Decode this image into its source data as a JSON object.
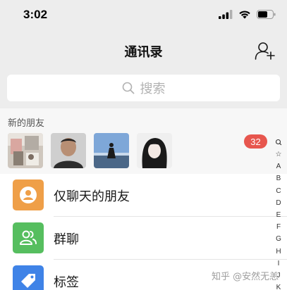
{
  "status_bar": {
    "time": "3:02"
  },
  "nav": {
    "title": "通讯录"
  },
  "search": {
    "placeholder": "搜索"
  },
  "new_friends": {
    "label": "新的朋友",
    "badge": "32"
  },
  "list": {
    "items": [
      {
        "label": "仅聊天的朋友",
        "icon": "chat-friend-icon",
        "color": "#ef9f48"
      },
      {
        "label": "群聊",
        "icon": "group-chat-icon",
        "color": "#56be5f"
      },
      {
        "label": "标签",
        "icon": "tag-icon",
        "color": "#3f83e7"
      }
    ]
  },
  "index_bar": {
    "letters": [
      "☆",
      "A",
      "B",
      "C",
      "D",
      "E",
      "F",
      "G",
      "H",
      "I",
      "J",
      "K"
    ]
  },
  "watermark": {
    "text": "知乎 @安然无恙"
  }
}
